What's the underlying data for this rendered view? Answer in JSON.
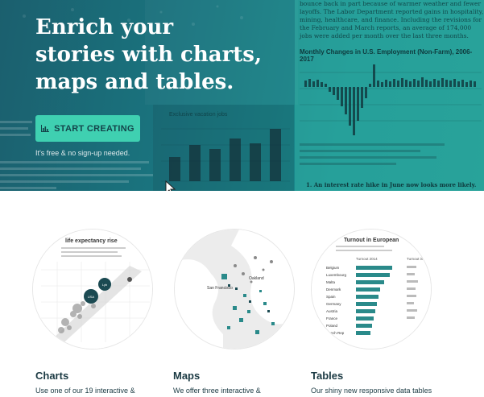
{
  "hero": {
    "headline": [
      "Enrich your",
      "stories with charts,",
      "maps and tables."
    ],
    "cta_label": "START CREATING",
    "cta_icon": "bar-chart-icon",
    "subtext": "It's free & no sign-up needed.",
    "bg_colors": {
      "start": "#1b5f6e",
      "end": "#1c8f8c",
      "accent": "#3fd0b1"
    },
    "bg_article": {
      "paragraph": "bounce back in part because of warmer weather and fewer layoffs. The Labor Department reported gains in hospitality, mining, healthcare, and finance. Including the revisions for the February and March reports, an average of 174,000 jobs were added per month over the last three months.",
      "chart_title": "Monthly Changes in U.S. Employment (Non-Farm), 2006-2017",
      "left_chart_title": "Exclusive vacation jobs",
      "bottom_line": "1. An interest rate hike in June now looks more likely."
    }
  },
  "features": [
    {
      "title": "Charts",
      "desc": "Use one of our 19 interactive &",
      "thumb_title": "life expectancy rise",
      "labels": [
        "USA",
        "Lyb"
      ]
    },
    {
      "title": "Maps",
      "desc": "We offer three interactive &",
      "labels": [
        "San Francisco",
        "Oakland"
      ]
    },
    {
      "title": "Tables",
      "desc": "Our shiny new responsive data tables",
      "thumb_title": "Turnout in European",
      "columns": [
        "Turnout 2014",
        "Turnout in"
      ],
      "rows": [
        "Belgium",
        "Luxembourg",
        "Malta",
        "Denmark",
        "Spain",
        "Germany",
        "Austria",
        "France",
        "Poland",
        "Czech Rep"
      ]
    }
  ]
}
